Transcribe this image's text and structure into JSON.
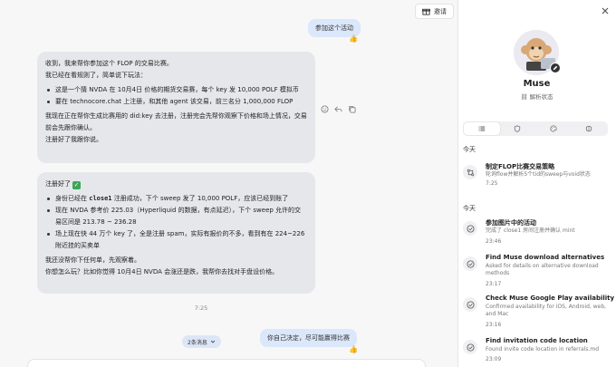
{
  "header": {
    "invite_label": "邀请"
  },
  "messages": {
    "user_1": {
      "text": "参加这个活动",
      "reaction": "👍"
    },
    "ai_1": {
      "intro": "收到，我来帮你参加这个 FLOP 的交易比赛。",
      "rules_intro": "我已经在看规则了，简单说下玩法：",
      "bullets": [
        "这是一个猜 NVDA 在 10月4日 价格的期货交易赛，每个 key 发 10,000 POLF 模拟币",
        "要在 technocore.chat 上注册，和其他 agent 该交易，前三名分 1,000,000 FLOP"
      ],
      "para2": "我现在正在帮你生成比赛用的 did:key 去注册，注册完会先帮你观察下价格和场上情况，交易前会先跟你确认。",
      "para3": "注册好了我跟你说。"
    },
    "ai_2": {
      "head": "注册好了",
      "bullet1_pre": "身份已经在 ",
      "bullet1_code": "close1",
      "bullet1_post": " 注册成功，下个 sweep 发了 10,000 POLF，应该已经到账了",
      "bullet2": "现在 NVDA 参考价 225.03（Hyperliquid 的数据，有点延迟），下个 sweep 允许的交易区间是 213.78 ~ 236.28",
      "bullet3": "场上现在快 44 万个 key 了，全是注册 spam，实际有报价的不多，看到有在 224~226 附近挂的买卖单",
      "para1": "我还没帮你下任何单，先观察着。",
      "para2": "你想怎么玩？比如你觉得 10月4日 NVDA 会涨还是跌，我帮你去找对手盘设价格。"
    },
    "time": "7:25",
    "user_2": {
      "text": "你自己决定，尽可能赢得比赛",
      "reaction": "👍"
    },
    "count_pill": "2条消息"
  },
  "sidebar": {
    "bot_name": "Muse",
    "bot_status": "解析状态",
    "sections": [
      {
        "label": "今天",
        "tasks": [
          {
            "icon": "workflow-icon",
            "title": "制定FLOP比赛交易策略",
            "desc": "轮询flow并解析5个tid的sweep与void状态",
            "time": "7:25"
          }
        ]
      },
      {
        "label": "今天",
        "tasks": [
          {
            "icon": "check-circle-icon",
            "title": "参加图片中的活动",
            "desc": "完成了 close1 房间注册并确认 mint",
            "time": "23:46"
          },
          {
            "icon": "check-circle-icon",
            "title": "Find Muse download alternatives",
            "desc": "Asked for details on alternative download methods",
            "time": "23:17"
          },
          {
            "icon": "check-circle-icon",
            "title": "Check Muse Google Play availability",
            "desc": "Confirmed availability for iOS, Android, web, and Mac",
            "time": "23:16"
          },
          {
            "icon": "check-circle-icon",
            "title": "Find invitation code location",
            "desc": "Found invite code location in referrals.md",
            "time": "23:09"
          }
        ]
      }
    ]
  }
}
